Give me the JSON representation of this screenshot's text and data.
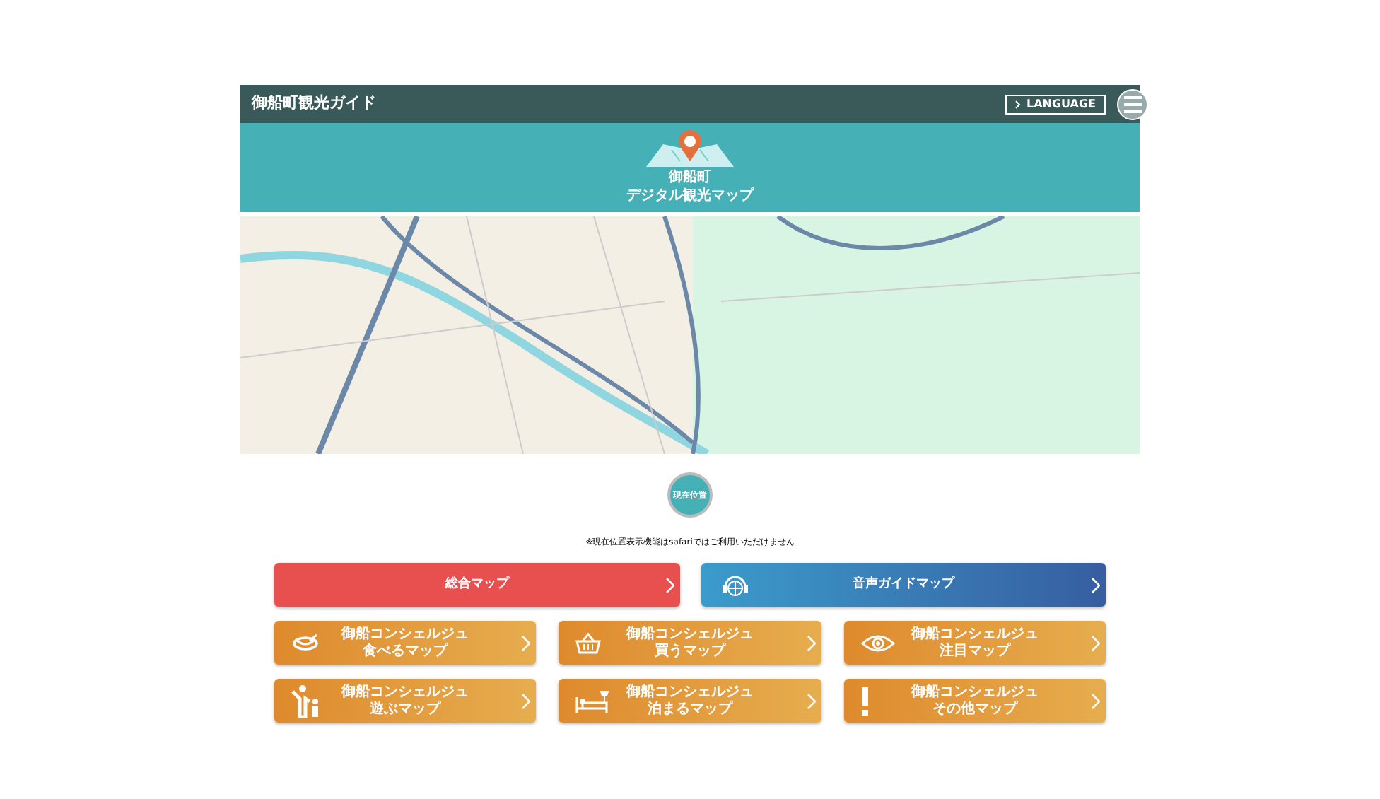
{
  "header": {
    "title": "御船町観光ガイド",
    "language_button": "LANGUAGE"
  },
  "banner": {
    "line1": "御船町",
    "line2": "デジタル観光マップ"
  },
  "location_button": "現在位置",
  "note": "※現在位置表示機能はsafariではご利用いただけません",
  "main_buttons": [
    {
      "kind": "general",
      "label": "総合マップ"
    },
    {
      "kind": "audio",
      "label": "音声ガイドマップ"
    }
  ],
  "category_buttons": [
    {
      "kind": "eat",
      "subtitle": "御船コンシェルジュ",
      "label": "食べるマップ"
    },
    {
      "kind": "buy",
      "subtitle": "御船コンシェルジュ",
      "label": "買うマップ"
    },
    {
      "kind": "watch",
      "subtitle": "御船コンシェルジュ",
      "label": "注目マップ"
    },
    {
      "kind": "play",
      "subtitle": "御船コンシェルジュ",
      "label": "遊ぶマップ"
    },
    {
      "kind": "stay",
      "subtitle": "御船コンシェルジュ",
      "label": "泊まるマップ"
    },
    {
      "kind": "other",
      "subtitle": "御船コンシェルジュ",
      "label": "その他マップ"
    }
  ]
}
